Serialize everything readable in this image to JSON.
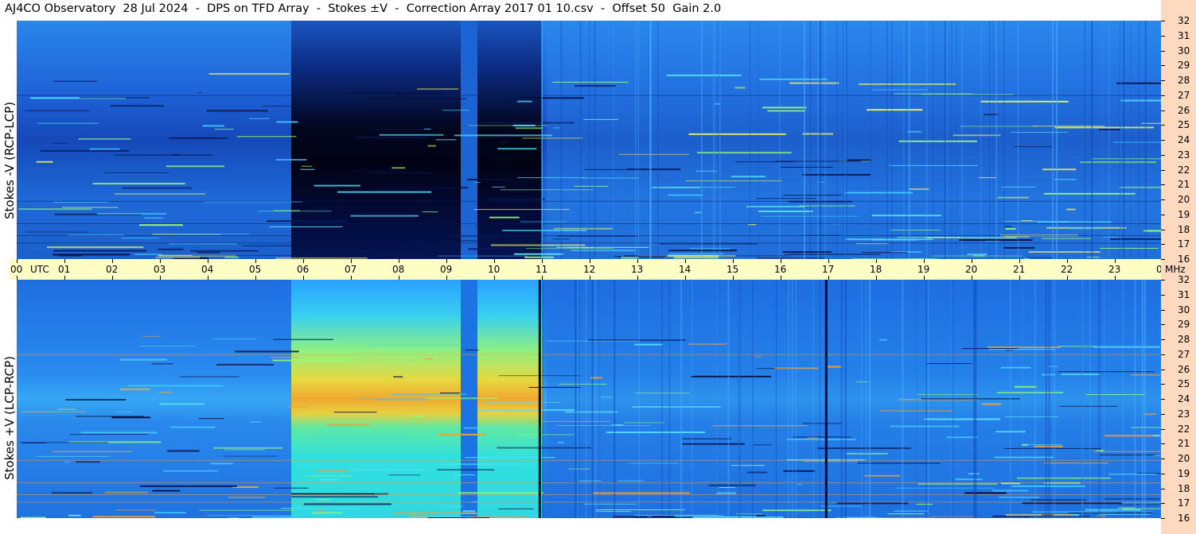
{
  "title": "AJ4CO Observatory  28 Jul 2024  -  DPS on TFD Array  -  Stokes ±V  -  Correction Array 2017 01 10.csv  -  Offset 50  Gain 2.0",
  "colors": {
    "freq_axis_bg": "#fcd9bf",
    "time_axis_bg": "#fdfdc4",
    "spectrogram_base": "#1f6ee0"
  },
  "chart_data": [
    {
      "type": "heatmap",
      "panel": "top",
      "ylabel": "Stokes -V (RCP-LCP)",
      "xlabel": "UTC",
      "x_unit": "UTC",
      "y_unit": "MHz",
      "x_ticks": [
        "00",
        "01",
        "02",
        "03",
        "04",
        "05",
        "06",
        "07",
        "08",
        "09",
        "10",
        "11",
        "12",
        "13",
        "14",
        "15",
        "16",
        "17",
        "18",
        "19",
        "20",
        "21",
        "22",
        "23",
        "00"
      ],
      "xlim": [
        0,
        24
      ],
      "ylim": [
        16,
        32
      ],
      "y_ticks": [
        "16",
        "17",
        "18",
        "19",
        "20",
        "21",
        "22",
        "23",
        "24",
        "25",
        "26",
        "27",
        "28",
        "29",
        "30",
        "31",
        "32"
      ],
      "features": [
        {
          "name": "dark band",
          "x_start": 5.75,
          "x_end": 9.3,
          "y_start": 16,
          "y_end": 32
        },
        {
          "name": "dark band",
          "x_start": 9.65,
          "x_end": 11.0,
          "y_start": 16,
          "y_end": 32
        }
      ]
    },
    {
      "type": "heatmap",
      "panel": "bottom",
      "ylabel": "Stokes +V (LCP-RCP)",
      "xlabel": "UTC",
      "x_unit": "UTC",
      "y_unit": "MHz",
      "x_ticks": [
        "00",
        "01",
        "02",
        "03",
        "04",
        "05",
        "06",
        "07",
        "08",
        "09",
        "10",
        "11",
        "12",
        "13",
        "14",
        "15",
        "16",
        "17",
        "18",
        "19",
        "20",
        "21",
        "22",
        "23",
        "00"
      ],
      "xlim": [
        0,
        24
      ],
      "ylim": [
        16,
        32
      ],
      "y_ticks": [
        "16",
        "17",
        "18",
        "19",
        "20",
        "21",
        "22",
        "23",
        "24",
        "25",
        "26",
        "27",
        "28",
        "29",
        "30",
        "31",
        "32"
      ],
      "features": [
        {
          "name": "bright band",
          "x_start": 5.75,
          "x_end": 9.3,
          "y_start": 16,
          "y_end": 32
        },
        {
          "name": "bright band",
          "x_start": 9.65,
          "x_end": 11.0,
          "y_start": 16,
          "y_end": 32
        }
      ]
    }
  ],
  "axis_labels": {
    "utc": "UTC",
    "mhz": "MHz"
  }
}
